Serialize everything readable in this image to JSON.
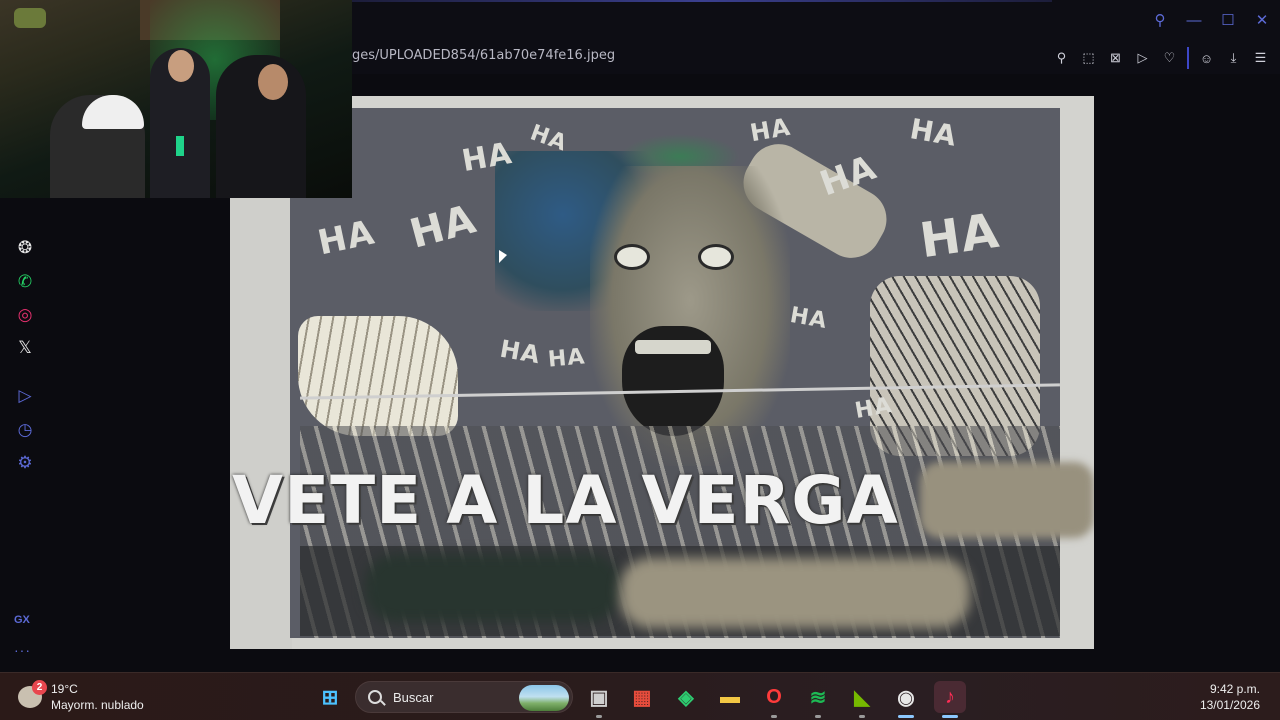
{
  "browser": {
    "url": "ges/UPLOADED854/61ab70e74fe16.jpeg",
    "window_controls": [
      "search-icon",
      "minimize-icon",
      "maximize-icon",
      "close-icon"
    ],
    "toolbar_icons": [
      "pin-icon",
      "snapshot-icon",
      "block-icon",
      "play-icon",
      "heart-icon",
      "profile-icon",
      "download-icon",
      "menu-icon"
    ],
    "accent_color": "#5c6ad6"
  },
  "sidebar": {
    "items": [
      {
        "name": "chatgpt-icon",
        "glyph": "❂",
        "color": "#e6e6e6"
      },
      {
        "name": "whatsapp-icon",
        "glyph": "✆",
        "color": "#25d366"
      },
      {
        "name": "instagram-icon",
        "glyph": "◎",
        "color": "#e1306c"
      },
      {
        "name": "x-icon",
        "glyph": "𝕏",
        "color": "#e6e6e6"
      },
      {
        "name": "player-icon",
        "glyph": "▷",
        "color": "#5c6ad6"
      },
      {
        "name": "history-icon",
        "glyph": "◷",
        "color": "#5c6ad6"
      },
      {
        "name": "settings-icon",
        "glyph": "⚙",
        "color": "#5c6ad6"
      }
    ],
    "gx_label": "GX",
    "more_label": "···"
  },
  "image": {
    "caption": "VETE A LA VERGA",
    "ha_text": "HA"
  },
  "taskbar": {
    "weather": {
      "badge": "2",
      "temp": "19°C",
      "condition": "Mayorm. nublado"
    },
    "search_label": "Buscar",
    "apps": [
      {
        "name": "windows-start-icon",
        "glyph": "⊞",
        "color": "#4cc2ff"
      },
      {
        "name": "task-view-icon",
        "glyph": "▣",
        "color": "#cfcfcf"
      },
      {
        "name": "microsoft-store-icon",
        "glyph": "▦",
        "color": "#e74c3c"
      },
      {
        "name": "m365-icon",
        "glyph": "◈",
        "color": "#2ecc71"
      },
      {
        "name": "file-explorer-icon",
        "glyph": "▬",
        "color": "#f2c744"
      },
      {
        "name": "opera-gx-icon",
        "glyph": "O",
        "color": "#ff3b3b"
      },
      {
        "name": "spotify-icon",
        "glyph": "≋",
        "color": "#1db954"
      },
      {
        "name": "nvidia-icon",
        "glyph": "◣",
        "color": "#76b900"
      },
      {
        "name": "obs-icon",
        "glyph": "◉",
        "color": "#e8e8e8"
      },
      {
        "name": "tiktok-icon",
        "glyph": "♪",
        "color": "#ff2c55"
      }
    ],
    "clock": {
      "time": "9:42 p.m.",
      "date": "13/01/2026"
    }
  }
}
